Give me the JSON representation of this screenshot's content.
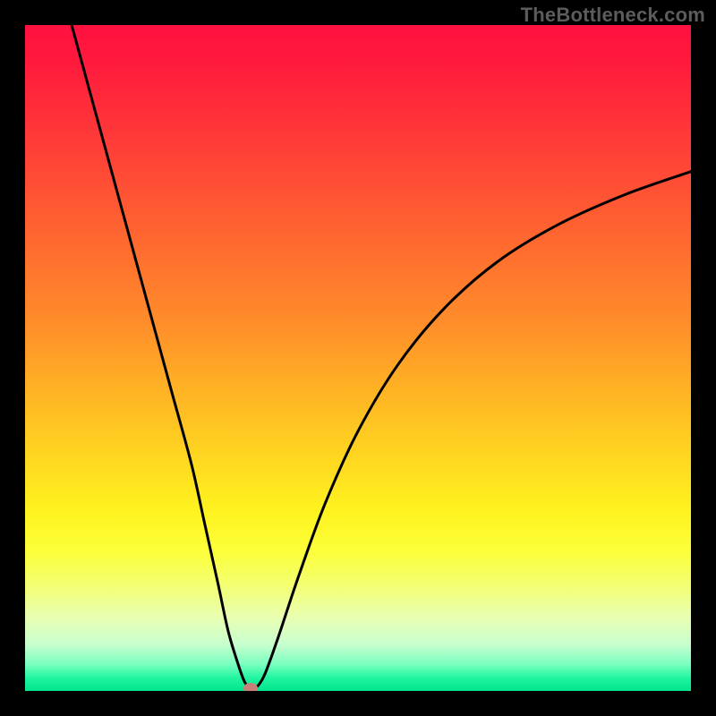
{
  "watermark": "TheBottleneck.com",
  "colors": {
    "curve_stroke": "#000000",
    "marker_fill": "#c98079",
    "frame_bg": "#000000"
  },
  "chart_data": {
    "type": "line",
    "title": "",
    "xlabel": "",
    "ylabel": "",
    "xlim": [
      0,
      100
    ],
    "ylim": [
      0,
      100
    ],
    "series": [
      {
        "name": "bottleneck-curve",
        "x": [
          7,
          10,
          13,
          16,
          19,
          22,
          25,
          27,
          29,
          30.5,
          32,
          33,
          33.9,
          34.8,
          36,
          38,
          41,
          45,
          50,
          56,
          63,
          71,
          80,
          90,
          100
        ],
        "y": [
          100,
          89,
          78,
          67,
          56,
          45,
          34,
          25,
          16,
          9,
          4,
          1.3,
          0.4,
          0.6,
          2.5,
          8,
          17,
          28,
          39,
          49,
          57.5,
          64.5,
          70,
          74.5,
          78
        ]
      }
    ],
    "marker": {
      "x": 33.9,
      "y": 0.4
    },
    "grid": false,
    "legend": false
  }
}
